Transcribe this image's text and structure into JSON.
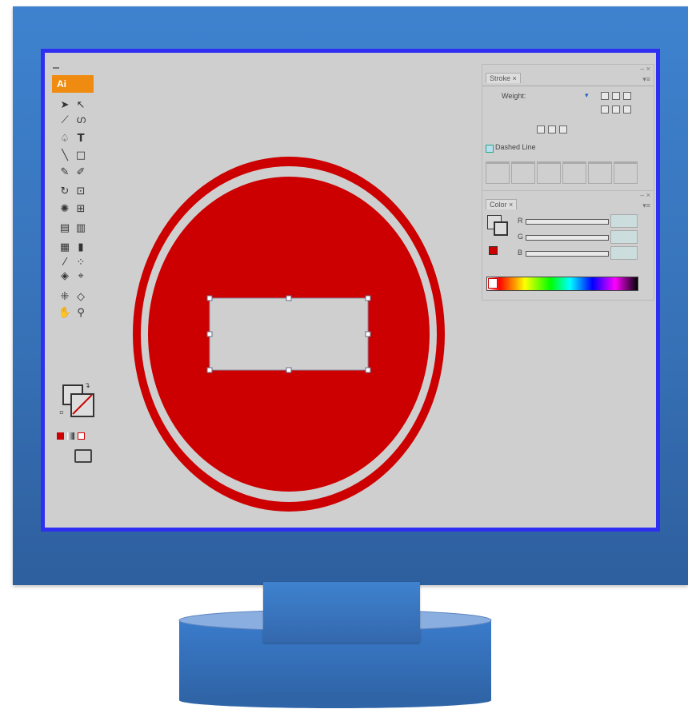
{
  "app": {
    "logo_text": "Ai"
  },
  "colors": {
    "monitor_blue": "#3a78c4",
    "screen_border": "#2f2ff2",
    "canvas_gray": "#cfcfcf",
    "sign_red": "#cc0000",
    "ai_orange": "#ef8b10"
  },
  "toolbar": {
    "tools": [
      "selection-tool",
      "direct-selection-tool",
      "magic-wand-tool",
      "lasso-tool",
      "pen-tool",
      "type-tool",
      "line-segment-tool",
      "rectangle-tool",
      "paintbrush-tool",
      "pencil-tool",
      "rotate-tool",
      "scale-tool",
      "warp-tool",
      "free-transform-tool",
      "symbol-sprayer-tool",
      "column-graph-tool",
      "mesh-tool",
      "gradient-tool",
      "eyedropper-tool",
      "blend-tool",
      "live-paint-bucket-tool",
      "live-paint-selection-tool",
      "slice-tool",
      "eraser-tool",
      "hand-tool",
      "zoom-tool"
    ]
  },
  "stroke_panel": {
    "tab_label": "Stroke",
    "weight_label": "Weight:",
    "dashed_line_label": "Dashed Line"
  },
  "color_panel": {
    "tab_label": "Color",
    "channels": [
      "R",
      "G",
      "B"
    ]
  }
}
